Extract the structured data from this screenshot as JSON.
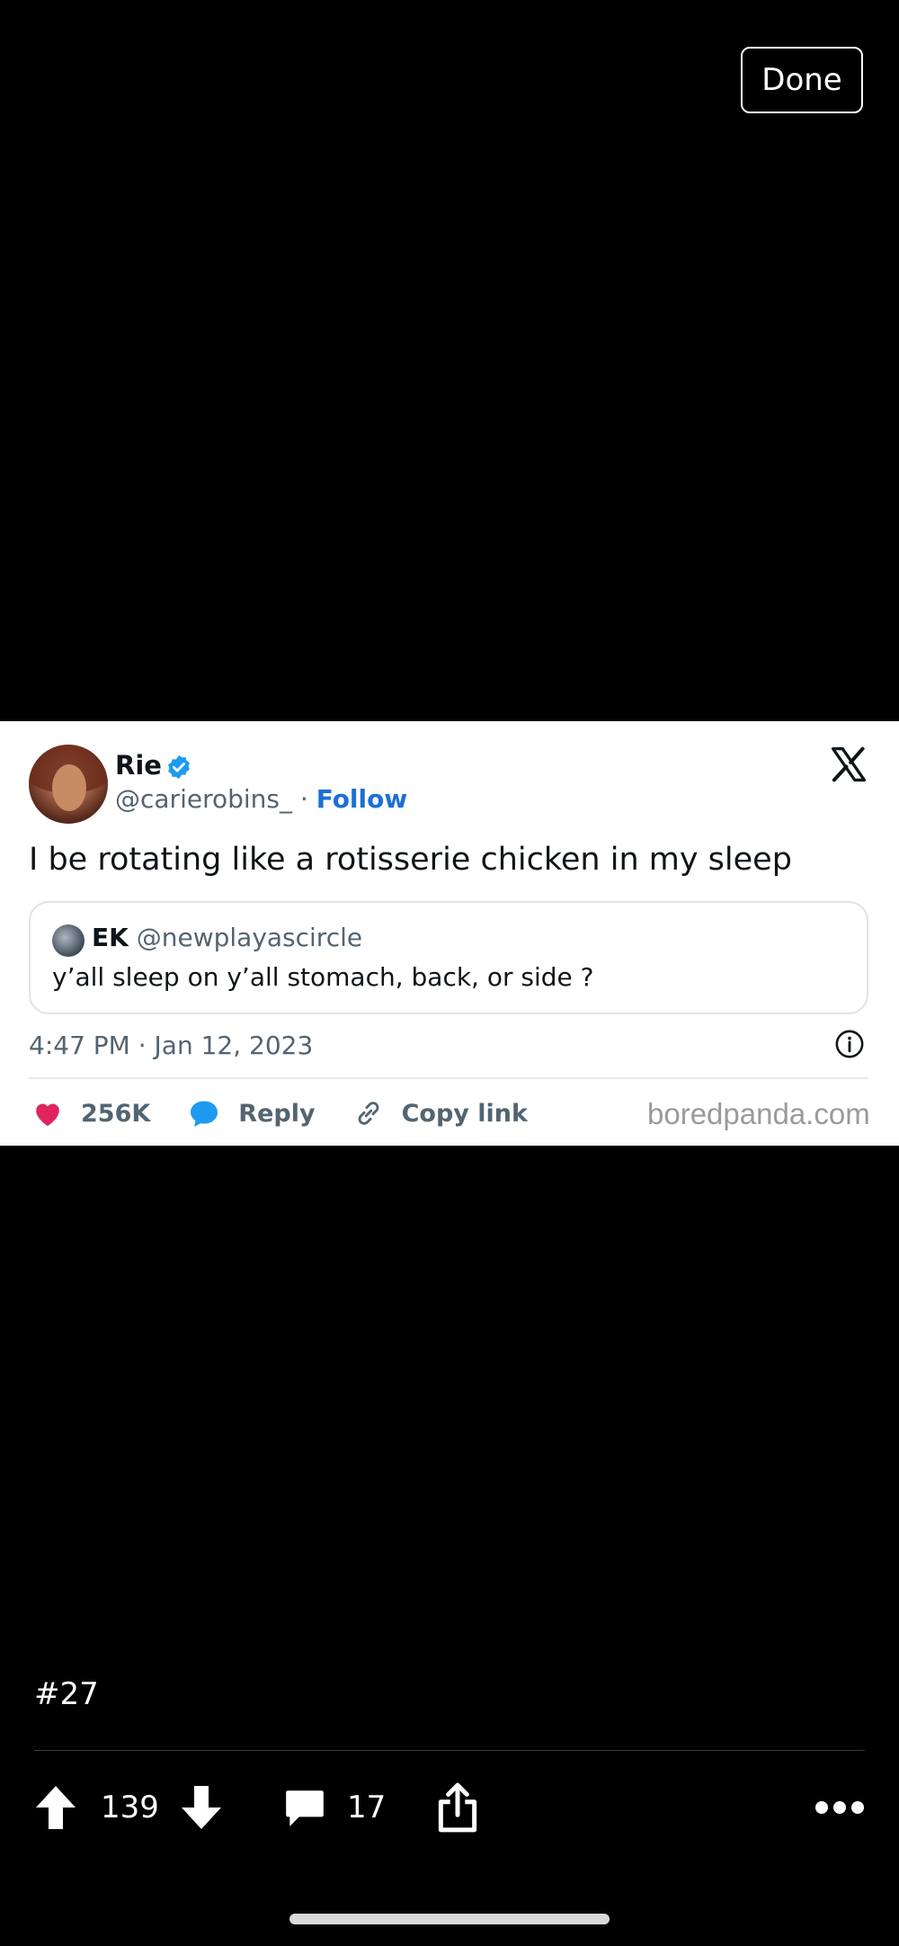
{
  "header": {
    "done_label": "Done"
  },
  "tweet": {
    "author_name": "Rie",
    "handle": "@carierobins_",
    "separator": "·",
    "follow_label": "Follow",
    "text": "I be rotating like a rotisserie chicken in my sleep",
    "quote": {
      "author_name": "EK",
      "handle": "@newplayascircle",
      "text": "y’all sleep on y’all stomach, back, or side ?"
    },
    "timestamp": "4:47 PM · Jan 12, 2023",
    "likes": "256K",
    "reply_label": "Reply",
    "copy_link_label": "Copy link",
    "watermark": "boredpanda.com",
    "colors": {
      "like": "#e0245e",
      "link_blue": "#1d6fd6",
      "verified": "#1d9bf0"
    }
  },
  "post": {
    "label": "#27",
    "upvotes": "139",
    "comments": "17"
  },
  "icons": [
    "upvote-icon",
    "downvote-icon",
    "comment-icon",
    "share-icon",
    "more-icon",
    "heart-icon",
    "reply-icon",
    "link-icon",
    "verified-icon",
    "x-logo-icon",
    "info-icon"
  ]
}
